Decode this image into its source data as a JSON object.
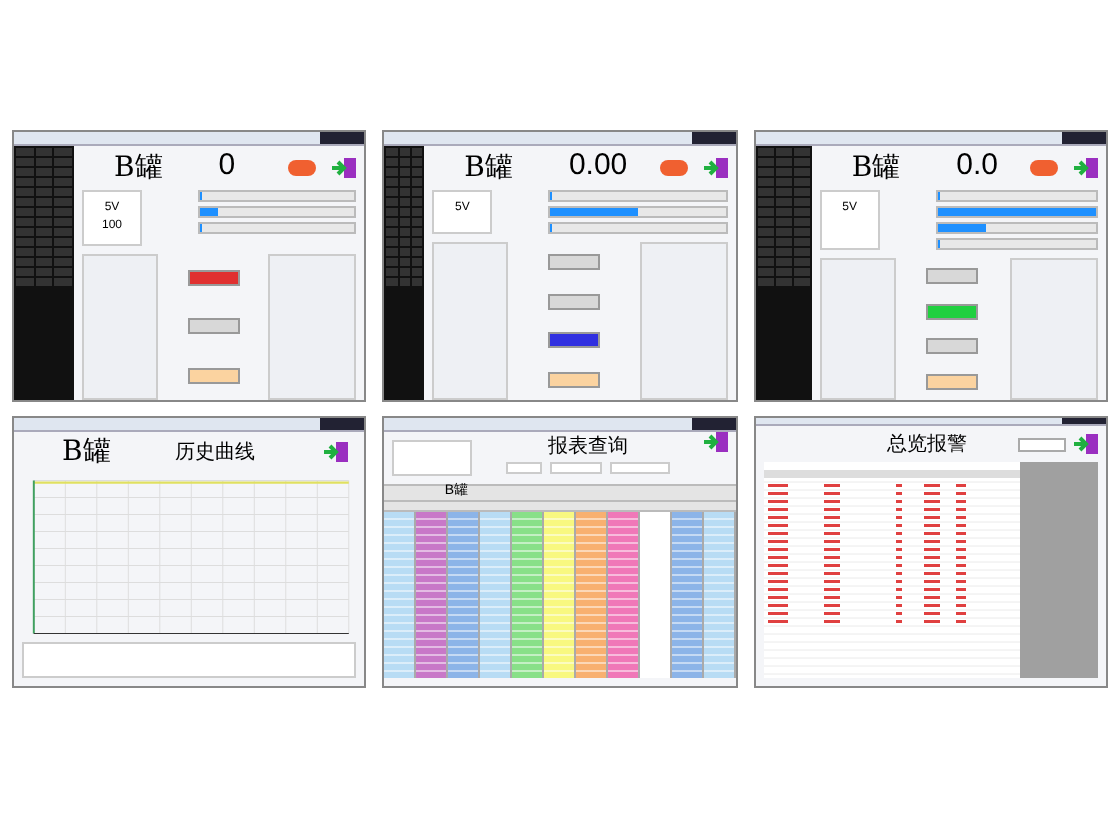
{
  "panels": [
    {
      "kind": "tank",
      "title": "B罐",
      "reading": "0",
      "voltage": "5V",
      "value": "100",
      "bars": [
        {
          "level": 0
        },
        {
          "level": 0.12
        },
        {
          "level": 0
        }
      ],
      "buttons": [
        {
          "color": "#e03030"
        },
        {
          "color": "#d8d8d8"
        },
        {
          "color": "#fbd3a0"
        }
      ]
    },
    {
      "kind": "tank",
      "title": "B罐",
      "reading": "0.00",
      "voltage": "5V",
      "bars": [
        {
          "level": 0
        },
        {
          "level": 0.5
        },
        {
          "level": 0
        }
      ],
      "buttons": [
        {
          "color": "#d8d8d8"
        },
        {
          "color": "#d8d8d8"
        },
        {
          "color": "#3030e0"
        },
        {
          "color": "#fbd3a0"
        }
      ]
    },
    {
      "kind": "tank",
      "title": "B罐",
      "reading": "0.0",
      "voltage": "5V",
      "bars": [
        {
          "level": 0
        },
        {
          "level": 1
        },
        {
          "level": 0.3
        },
        {
          "level": 0
        }
      ],
      "buttons": [
        {
          "color": "#d8d8d8"
        },
        {
          "color": "#20d040"
        },
        {
          "color": "#d8d8d8"
        },
        {
          "color": "#fbd3a0"
        }
      ]
    },
    {
      "kind": "trend",
      "title": "B罐",
      "heading": "历史曲线"
    },
    {
      "kind": "report",
      "heading": "报表查询",
      "title": "B罐",
      "columns": [
        {
          "color": "#b8dcf4"
        },
        {
          "color": "#c878c8"
        },
        {
          "color": "#8cb4e8"
        },
        {
          "color": "#b8dcf4"
        },
        {
          "color": "#88e088"
        },
        {
          "color": "#f8f880"
        },
        {
          "color": "#f8b070"
        },
        {
          "color": "#f078b8"
        },
        {
          "color": "#ffffff"
        },
        {
          "color": "#8cb4e8"
        },
        {
          "color": "#b8dcf4"
        }
      ]
    },
    {
      "kind": "alarm",
      "heading": "总览报警"
    }
  ]
}
